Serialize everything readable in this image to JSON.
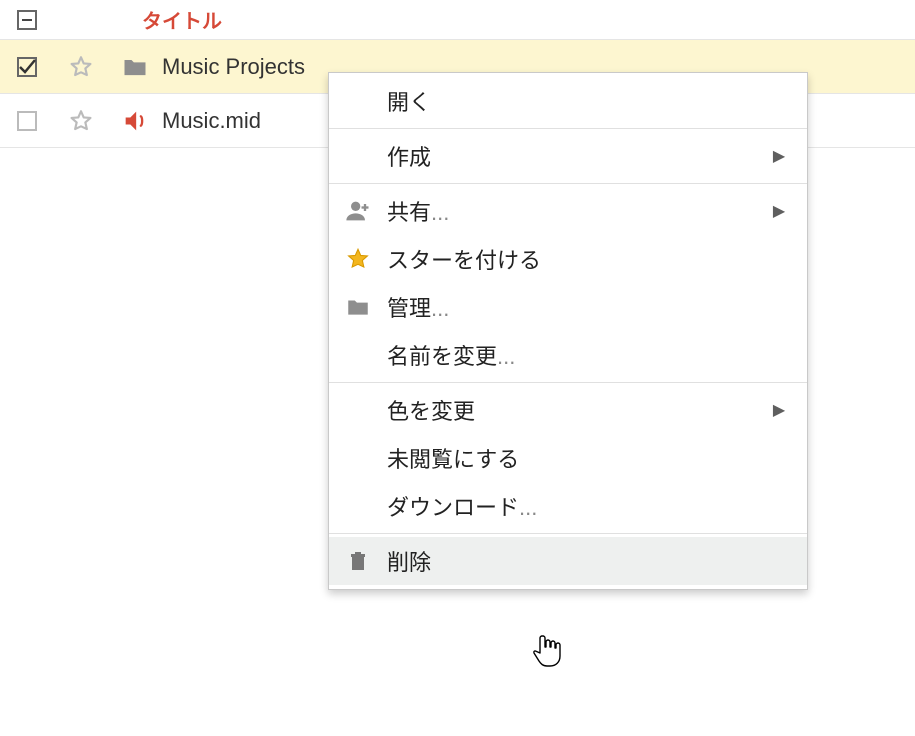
{
  "header": {
    "title": "タイトル"
  },
  "rows": [
    {
      "checked": true,
      "starred": false,
      "kind": "folder",
      "title": "Music Projects"
    },
    {
      "checked": false,
      "starred": false,
      "kind": "audio",
      "title": "Music.mid"
    }
  ],
  "menu": {
    "open": "開く",
    "create": "作成",
    "share": "共有",
    "star": "スターを付ける",
    "manage": "管理",
    "rename": "名前を変更",
    "change_color": "色を変更",
    "mark_unread": "未閲覧にする",
    "download": "ダウンロード",
    "delete": "削除"
  }
}
